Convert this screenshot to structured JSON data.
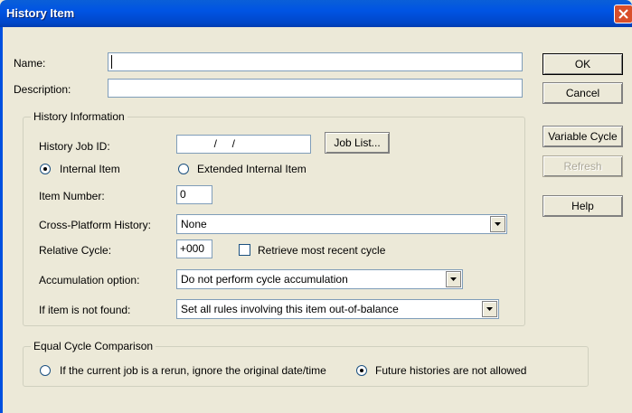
{
  "window": {
    "title": "History Item"
  },
  "fields": {
    "name_label": "Name:",
    "name_value": "",
    "description_label": "Description:",
    "description_value": ""
  },
  "history_info": {
    "group_label": "History Information",
    "job_id_label": "History Job ID:",
    "job_id_value": "  /     /",
    "job_list_button": "Job List...",
    "internal_item": "Internal Item",
    "extended_internal_item": "Extended Internal Item",
    "item_number_label": "Item Number:",
    "item_number_value": "0",
    "cross_platform_label": "Cross-Platform History:",
    "cross_platform_value": "None",
    "relative_cycle_label": "Relative Cycle:",
    "relative_cycle_value": "+000",
    "retrieve_recent_label": "Retrieve most recent cycle",
    "accumulation_label": "Accumulation option:",
    "accumulation_value": "Do not perform cycle accumulation",
    "not_found_label": "If item is not found:",
    "not_found_value": "Set all rules involving this item out-of-balance"
  },
  "equal_cycle": {
    "group_label": "Equal Cycle Comparison",
    "rerun_option": "If the current job is a rerun, ignore the original date/time",
    "future_option": "Future histories are not allowed"
  },
  "buttons": {
    "ok": "OK",
    "cancel": "Cancel",
    "variable_cycle": "Variable Cycle",
    "refresh": "Refresh",
    "help": "Help"
  },
  "state": {
    "item_type_selected": "Internal Item",
    "equal_cycle_selected": "Future histories are not allowed",
    "retrieve_recent_checked": false,
    "refresh_enabled": false
  }
}
